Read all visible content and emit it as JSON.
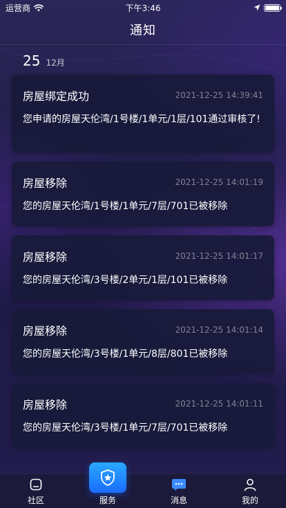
{
  "status_bar": {
    "carrier": "运营商",
    "time": "下午3:46"
  },
  "header": {
    "title": "通知"
  },
  "date_group": {
    "day": "25",
    "month": "12月"
  },
  "notifications": [
    {
      "title": "房屋绑定成功",
      "time": "2021-12-25 14:39:41",
      "body": "您申请的房屋天伦湾/1号楼/1单元/1层/101通过审核了!"
    },
    {
      "title": "房屋移除",
      "time": "2021-12-25 14:01:19",
      "body": "您的房屋天伦湾/1号楼/1单元/7层/701已被移除"
    },
    {
      "title": "房屋移除",
      "time": "2021-12-25 14:01:17",
      "body": "您的房屋天伦湾/3号楼/2单元/1层/101已被移除"
    },
    {
      "title": "房屋移除",
      "time": "2021-12-25 14:01:14",
      "body": "您的房屋天伦湾/3号楼/1单元/8层/801已被移除"
    },
    {
      "title": "房屋移除",
      "time": "2021-12-25 14:01:11",
      "body": "您的房屋天伦湾/3号楼/1单元/7层/701已被移除"
    }
  ],
  "tabbar": {
    "tabs": [
      {
        "label": "社区",
        "icon": "community-icon"
      },
      {
        "label": "服务",
        "icon": "shield-star-icon"
      },
      {
        "label": "消息",
        "icon": "message-icon"
      },
      {
        "label": "我的",
        "icon": "profile-icon"
      }
    ],
    "active_index": 2,
    "active_color": "#3a8bff"
  }
}
